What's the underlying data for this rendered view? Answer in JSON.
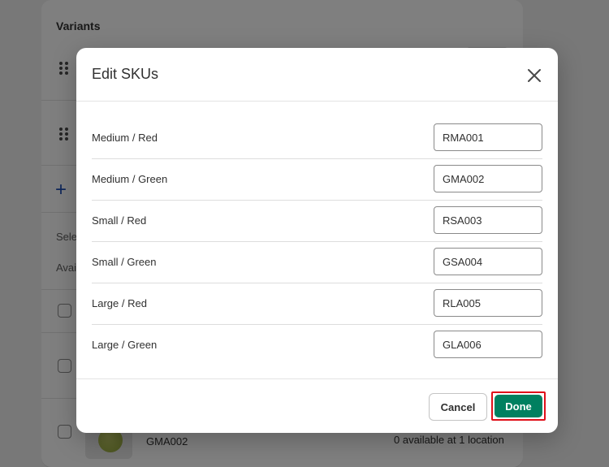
{
  "background": {
    "card_title": "Variants",
    "partial_select_text": "Sele",
    "partial_available_text": "Avai",
    "row_sku": "GMA002",
    "row_availability": "0 available at 1 location"
  },
  "modal": {
    "title": "Edit SKUs",
    "rows": [
      {
        "label": "Medium / Red",
        "sku": "RMA001"
      },
      {
        "label": "Medium / Green",
        "sku": "GMA002"
      },
      {
        "label": "Small / Red",
        "sku": "RSA003"
      },
      {
        "label": "Small / Green",
        "sku": "GSA004"
      },
      {
        "label": "Large / Red",
        "sku": "RLA005"
      },
      {
        "label": "Large / Green",
        "sku": "GLA006"
      }
    ],
    "cancel_label": "Cancel",
    "done_label": "Done"
  },
  "colors": {
    "primary": "#008060",
    "highlight": "#e0101a",
    "accent_link": "#1e4fb5"
  },
  "icons": {
    "close": "close-icon",
    "drag": "drag-handle-icon",
    "add": "plus-icon"
  }
}
